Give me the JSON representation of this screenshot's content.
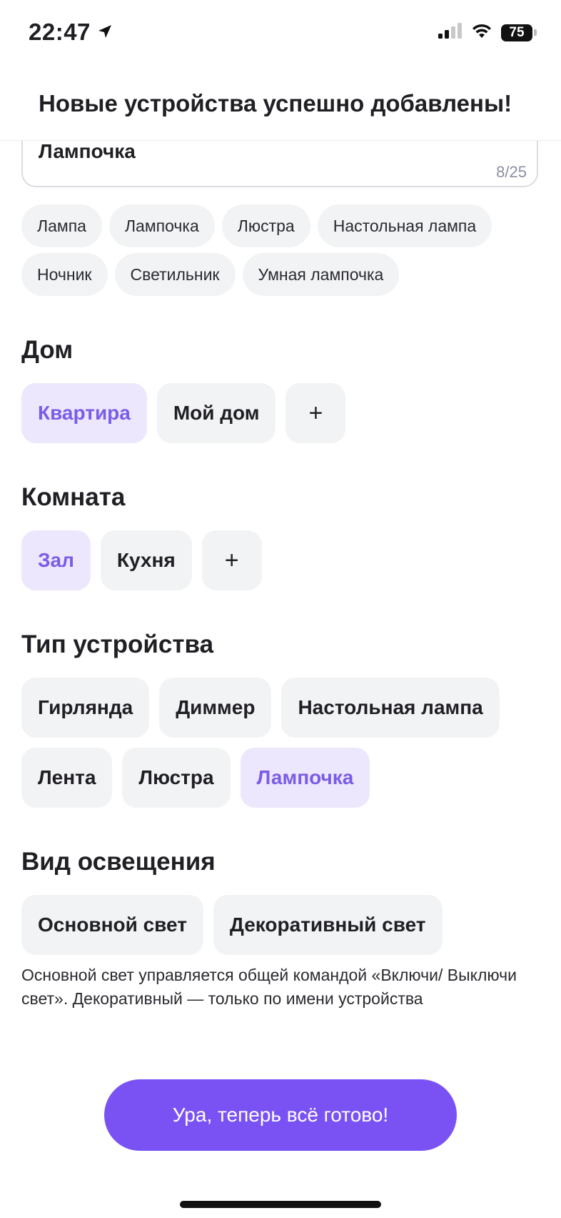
{
  "status_bar": {
    "time": "22:47",
    "battery": "75"
  },
  "header": {
    "title": "Новые устройства успешно добавлены!"
  },
  "name_field": {
    "value": "Лампочка",
    "counter": "8/25"
  },
  "suggestions": {
    "row1": [
      "Лампа",
      "Лампочка",
      "Люстра",
      "Настольная лампа"
    ],
    "row2": [
      "Ночник",
      "Светильник",
      "Умная лампочка"
    ]
  },
  "home": {
    "title": "Дом",
    "options": [
      "Квартира",
      "Мой дом"
    ],
    "selected": "Квартира",
    "add_label": "+"
  },
  "room": {
    "title": "Комната",
    "options": [
      "Зал",
      "Кухня"
    ],
    "selected": "Зал",
    "add_label": "+"
  },
  "device_type": {
    "title": "Тип устройства",
    "options": [
      "Гирлянда",
      "Диммер",
      "Настольная лампа",
      "Лента",
      "Люстра",
      "Лампочка"
    ],
    "selected": "Лампочка"
  },
  "lighting": {
    "title": "Вид освещения",
    "options": [
      "Основной свет",
      "Декоративный свет"
    ],
    "hint": "Основной свет управляется общей командой «Включи/ Выключи свет». Декоративный — только по имени устройства"
  },
  "primary_button": {
    "label": "Ура, теперь всё готово!"
  },
  "colors": {
    "accent": "#7a52f4",
    "selected_chip_bg": "#ece7fd",
    "selected_chip_text": "#7b5ce8",
    "chip_bg": "#f2f3f5"
  }
}
